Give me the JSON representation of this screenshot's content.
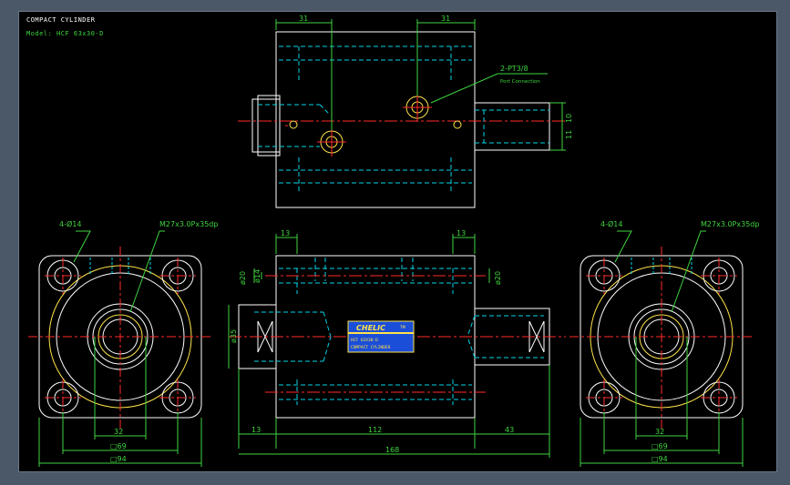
{
  "title_block": {
    "title": "COMPACT CYLINDER",
    "model": "Model: HCF 63x30-D"
  },
  "annotations": {
    "port": "2-PT3/8",
    "port_sub": "Port Connection",
    "holes": "4-Ø14",
    "thread": "M27x3.0Px35dp"
  },
  "dims": {
    "top_left": "31",
    "top_right": "31",
    "top_small_a": "10",
    "top_small_b": "11",
    "front_13_left": "13",
    "front_13_right": "13",
    "d20_left": "ø20",
    "d14": "ø14",
    "d20_right": "ø20",
    "d35": "ø35",
    "bottom_13": "13",
    "bottom_112": "112",
    "bottom_43": "43",
    "bottom_168": "168",
    "side_32": "32",
    "side_69": "□69",
    "side_94": "□94"
  },
  "nameplate": {
    "brand": "CHELIC",
    "tm": "TM",
    "line1": "HCF 63X30-D",
    "line2": "COMPACT CYLINDER"
  },
  "colors": {
    "background": "#000000",
    "outline": "#ffffff",
    "hidden": "#00d4e8",
    "center": "#ff2a2a",
    "dimension": "#3fd43f",
    "highlight": "#ffe34a",
    "nameplate": "#1b4ed8"
  }
}
